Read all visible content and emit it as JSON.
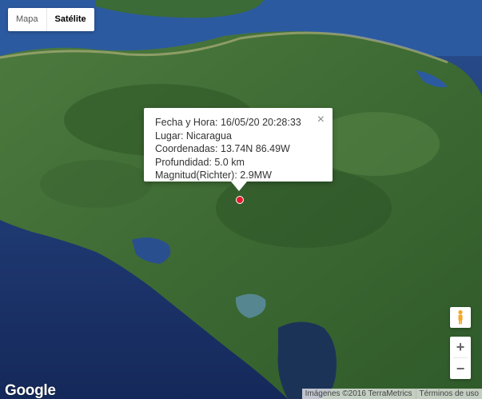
{
  "map_type_control": {
    "map_label": "Mapa",
    "satellite_label": "Satélite",
    "selected": "Satélite"
  },
  "info_window": {
    "lines": [
      "Fecha y Hora: 16/05/20 20:28:33",
      "Lugar: Nicaragua",
      "Coordenadas: 13.74N 86.49W",
      "Profundidad: 5.0 km",
      "Magnitud(Richter): 2.9MW"
    ],
    "close_symbol": "×"
  },
  "controls": {
    "zoom_in": "+",
    "zoom_out": "−",
    "pegman_icon": "pegman-icon"
  },
  "branding": {
    "logo_text": "Google",
    "imagery_credit": "Imágenes ©2016 TerraMetrics",
    "terms_link": "Términos de uso"
  },
  "colors": {
    "marker": "#e21b2a",
    "ocean": "#1f3f7a",
    "land": "#3f6a35"
  }
}
